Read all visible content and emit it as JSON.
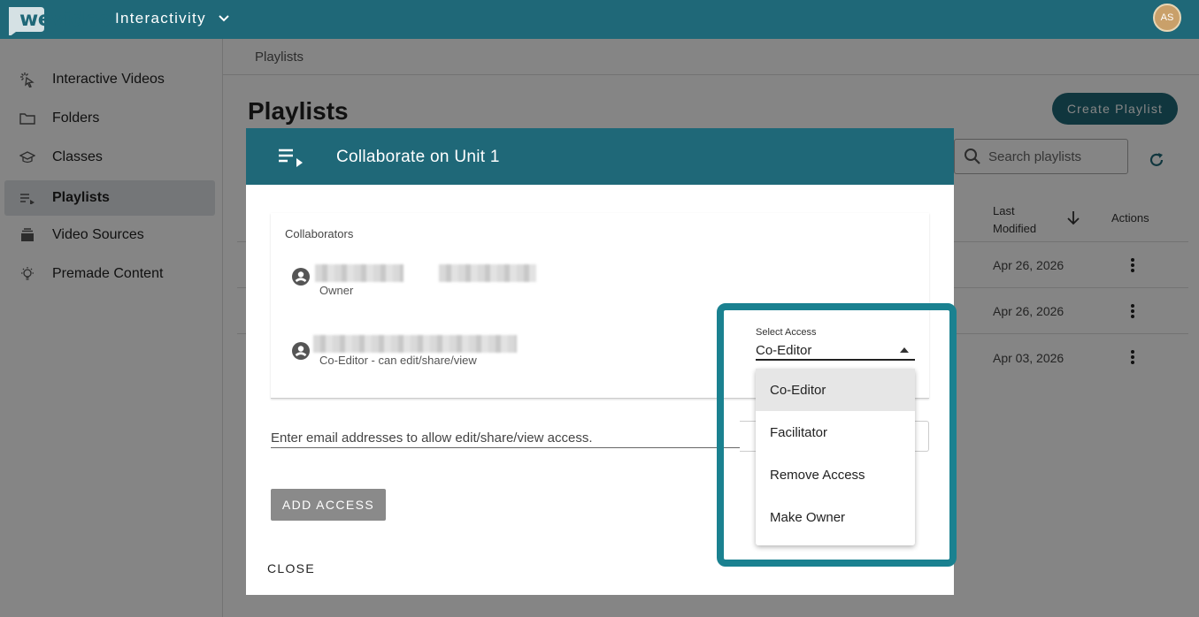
{
  "app": {
    "logo_text": "wevideo",
    "product_name": "Interactivity",
    "user_initials": "AS"
  },
  "sidebar": {
    "items": [
      {
        "label": "Interactive Videos",
        "icon": "pointer-click-icon"
      },
      {
        "label": "Folders",
        "icon": "folder-icon"
      },
      {
        "label": "Classes",
        "icon": "graduation-cap-icon"
      },
      {
        "label": "Playlists",
        "icon": "playlist-icon",
        "active": true
      },
      {
        "label": "Video Sources",
        "icon": "video-stack-icon"
      },
      {
        "label": "Premade Content",
        "icon": "lightbulb-icon"
      }
    ]
  },
  "main": {
    "breadcrumb": "Playlists",
    "title": "Playlists",
    "create_button": "Create Playlist",
    "search_placeholder": "Search playlists",
    "columns": {
      "last_modified_line1": "Last",
      "last_modified_line2": "Modified",
      "actions": "Actions"
    },
    "rows": [
      {
        "last_modified": "Apr 26, 2026"
      },
      {
        "last_modified": "Apr 26, 2026"
      },
      {
        "last_modified": "Apr 03, 2026"
      }
    ]
  },
  "dialog": {
    "title": "Collaborate on Unit 1",
    "collaborators_heading": "Collaborators",
    "collaborators": [
      {
        "role": "Owner"
      },
      {
        "role": "Co-Editor - can edit/share/view"
      }
    ],
    "email_placeholder": "Enter email addresses to allow edit/share/view access.",
    "add_button": "ADD ACCESS",
    "close_button": "CLOSE"
  },
  "access_select": {
    "label": "Select Access",
    "value": "Co-Editor",
    "options": [
      "Co-Editor",
      "Facilitator",
      "Remove Access",
      "Make Owner"
    ],
    "selected_index": 0
  },
  "colors": {
    "brand": "#1f6878",
    "highlight": "#1a8190"
  }
}
